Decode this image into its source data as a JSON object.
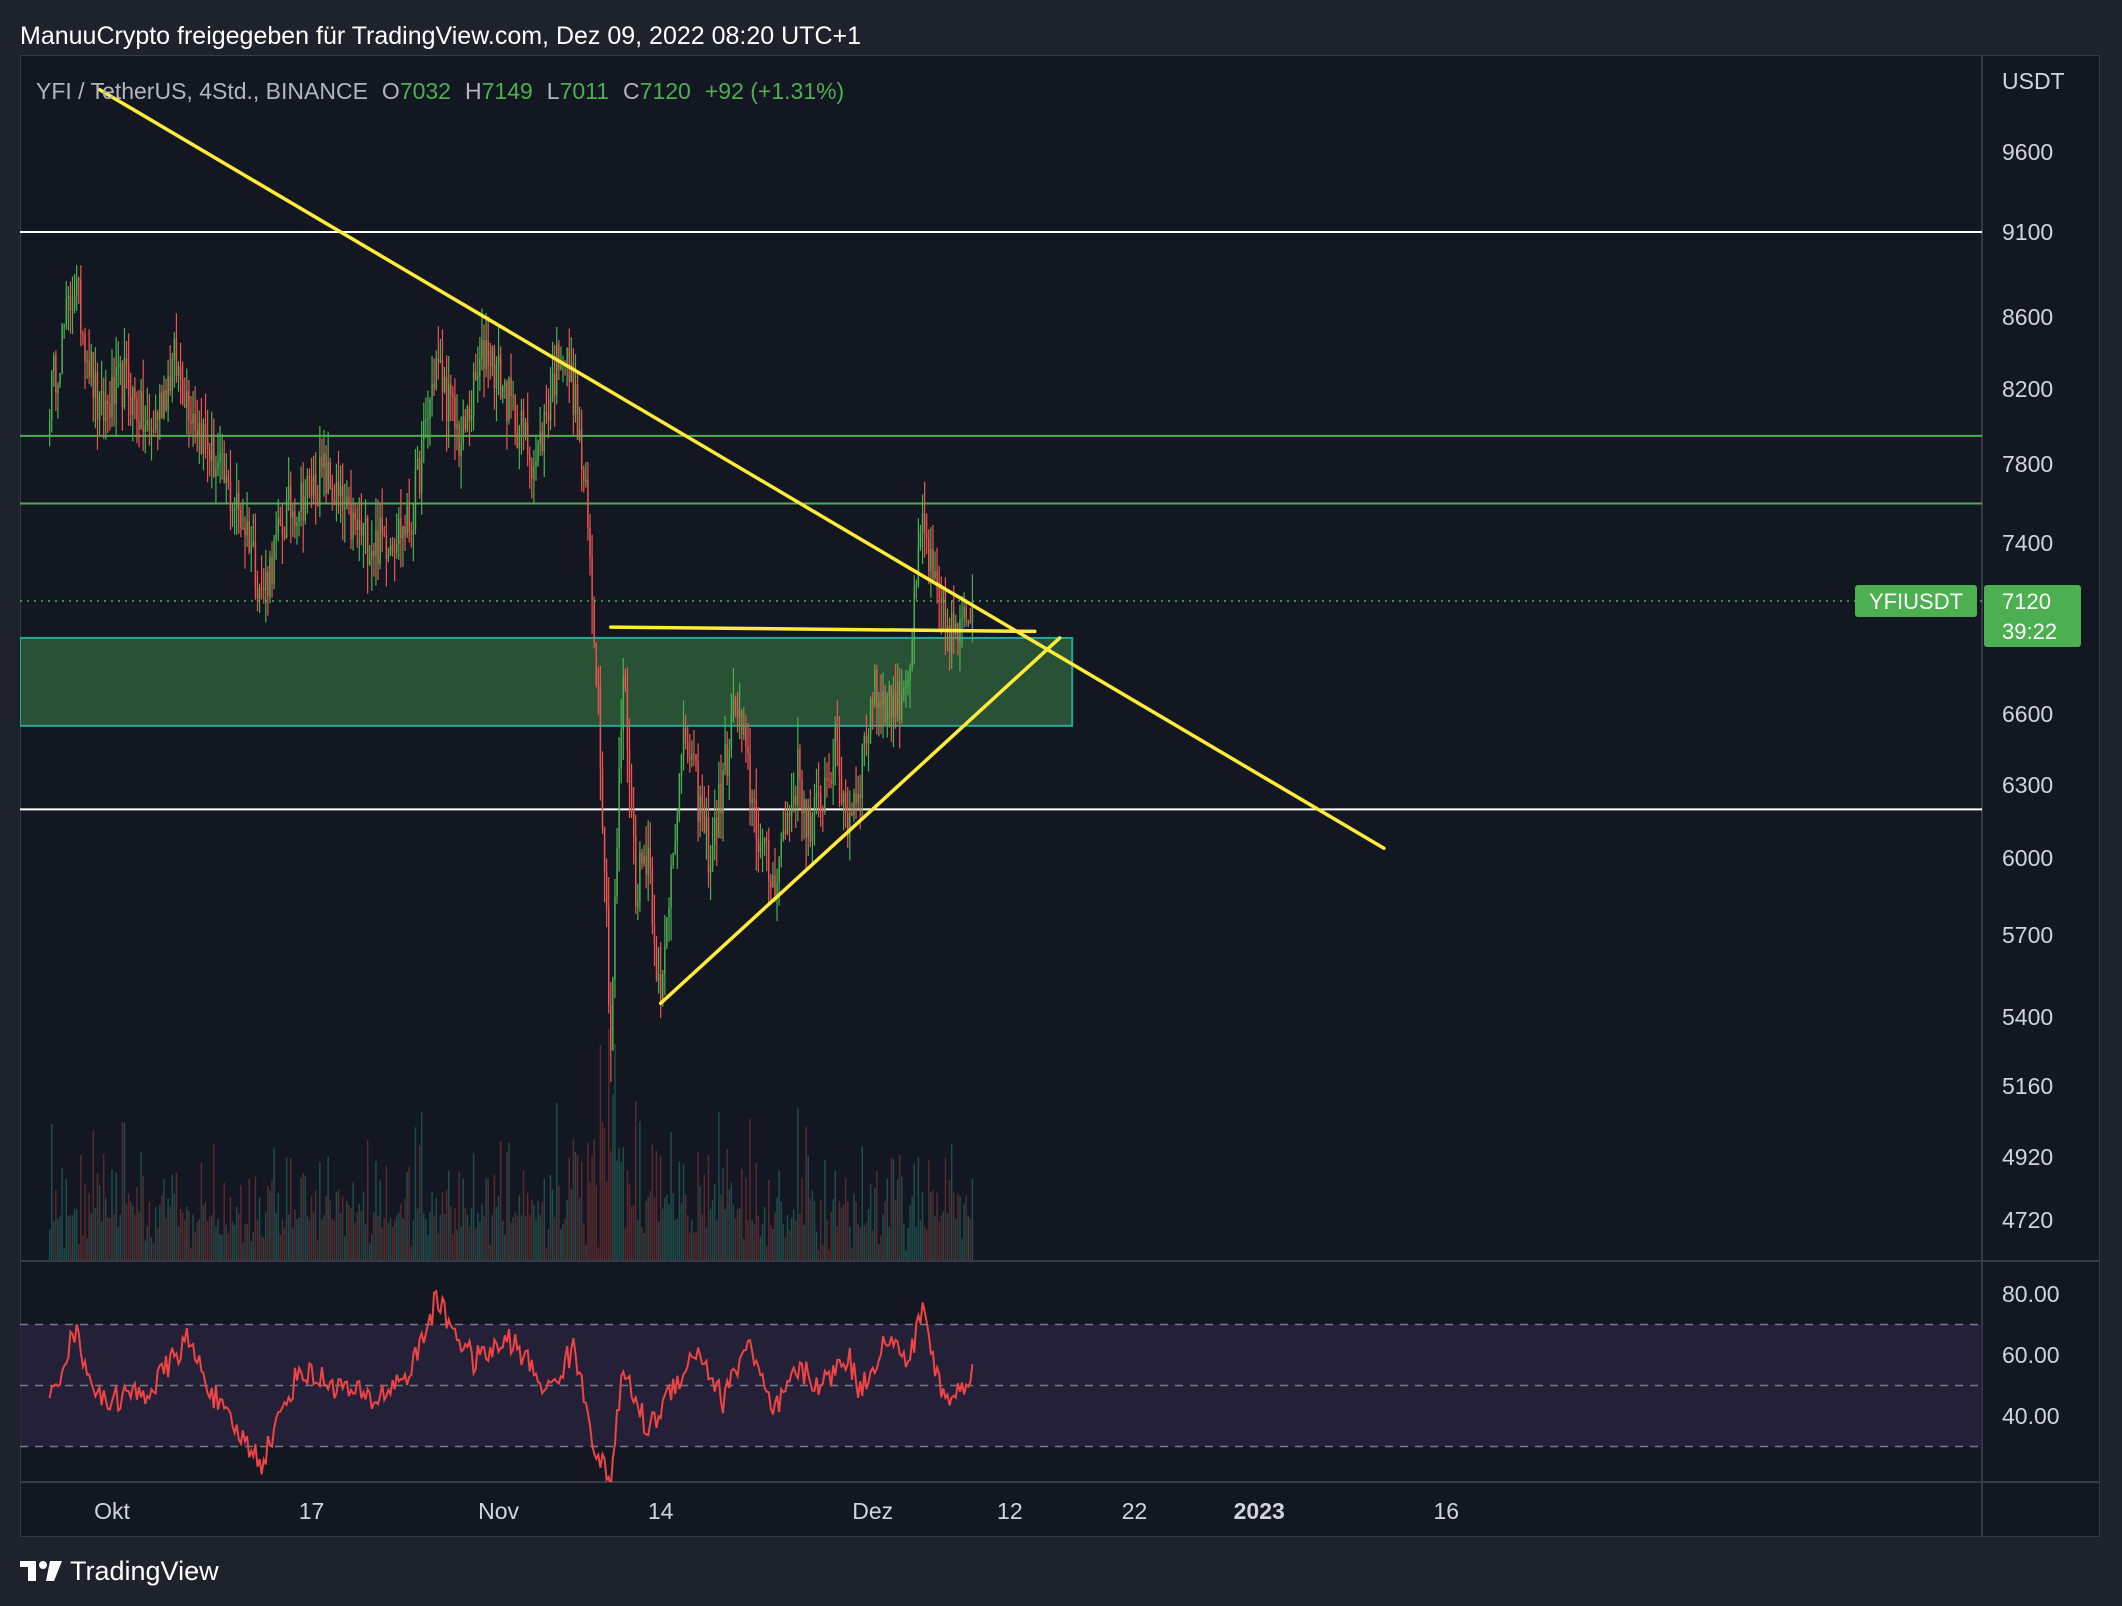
{
  "header_text": "ManuuCrypto freigegeben für TradingView.com, Dez 09, 2022 08:20 UTC+1",
  "footer_brand": "TradingView",
  "legend": {
    "symbol": "YFI / TetherUS, 4Std., BINANCE",
    "o_label": "O",
    "o_value": "7032",
    "h_label": "H",
    "h_value": "7149",
    "l_label": "L",
    "l_value": "7011",
    "c_label": "C",
    "c_value": "7120",
    "change": "+92 (+1.31%)"
  },
  "colors": {
    "up": "#26a69a",
    "up_body": "#4caf50",
    "down": "#ef5350",
    "trendline": "#ffeb3b",
    "zone": "#2e5c38",
    "badge": "#4caf50",
    "rsi_line": "#ef4444"
  },
  "chart_data": {
    "type": "candlestick",
    "symbol": "YFIUSDT",
    "timeframe": "4Std.",
    "price_axis_unit": "USDT",
    "price_ticks": [
      9600,
      9100,
      8600,
      8200,
      7800,
      7400,
      6600,
      6300,
      6000,
      5700,
      5400,
      5160,
      4920,
      4720
    ],
    "time_ticks": [
      {
        "label": "Okt",
        "date": "2022-10-01",
        "bold": false
      },
      {
        "label": "17",
        "date": "2022-10-17",
        "bold": false
      },
      {
        "label": "Nov",
        "date": "2022-11-01",
        "bold": false
      },
      {
        "label": "14",
        "date": "2022-11-14",
        "bold": false
      },
      {
        "label": "Dez",
        "date": "2022-12-01",
        "bold": false
      },
      {
        "label": "12",
        "date": "2022-12-12",
        "bold": false
      },
      {
        "label": "22",
        "date": "2022-12-22",
        "bold": false
      },
      {
        "label": "2023",
        "date": "2023-01-01",
        "bold": true
      },
      {
        "label": "16",
        "date": "2023-01-16",
        "bold": false
      }
    ],
    "series_anchors": [
      [
        "2022-09-26",
        8150
      ],
      [
        "2022-09-28",
        8800
      ],
      [
        "2022-09-30",
        8050
      ],
      [
        "2022-10-02",
        8250
      ],
      [
        "2022-10-04",
        7950
      ],
      [
        "2022-10-06",
        8350
      ],
      [
        "2022-10-08",
        8000
      ],
      [
        "2022-10-10",
        7700
      ],
      [
        "2022-10-12",
        7450
      ],
      [
        "2022-10-13",
        7150
      ],
      [
        "2022-10-15",
        7550
      ],
      [
        "2022-10-18",
        7750
      ],
      [
        "2022-10-20",
        7500
      ],
      [
        "2022-10-22",
        7400
      ],
      [
        "2022-10-25",
        7500
      ],
      [
        "2022-10-27",
        8350
      ],
      [
        "2022-10-29",
        7900
      ],
      [
        "2022-10-31",
        8450
      ],
      [
        "2022-11-02",
        8100
      ],
      [
        "2022-11-04",
        7800
      ],
      [
        "2022-11-06",
        8450
      ],
      [
        "2022-11-07",
        8200
      ],
      [
        "2022-11-08",
        7600
      ],
      [
        "2022-11-09",
        6700
      ],
      [
        "2022-11-10",
        5300
      ],
      [
        "2022-11-11",
        6800
      ],
      [
        "2022-11-12",
        5900
      ],
      [
        "2022-11-13",
        6050
      ],
      [
        "2022-11-14",
        5400
      ],
      [
        "2022-11-15",
        6100
      ],
      [
        "2022-11-16",
        6500
      ],
      [
        "2022-11-18",
        6000
      ],
      [
        "2022-11-20",
        6650
      ],
      [
        "2022-11-22",
        6050
      ],
      [
        "2022-11-23",
        5900
      ],
      [
        "2022-11-25",
        6350
      ],
      [
        "2022-11-26",
        6100
      ],
      [
        "2022-11-28",
        6450
      ],
      [
        "2022-11-29",
        6150
      ],
      [
        "2022-11-30",
        6350
      ],
      [
        "2022-12-01",
        6700
      ],
      [
        "2022-12-03",
        6650
      ],
      [
        "2022-12-04",
        6850
      ],
      [
        "2022-12-05",
        7500
      ],
      [
        "2022-12-06",
        7150
      ],
      [
        "2022-12-07",
        7000
      ],
      [
        "2022-12-08",
        6950
      ],
      [
        "2022-12-09",
        7120
      ]
    ],
    "candles_per_day": 6,
    "last_price": 7120,
    "horizontal_levels": [
      {
        "price": 9100,
        "color": "#ffffff"
      },
      {
        "price": 7950,
        "color": "#4caf50"
      },
      {
        "price": 7600,
        "color": "#4caf50"
      },
      {
        "price": 6200,
        "color": "#ffffff"
      }
    ],
    "zone": {
      "from_date": "2022-09-26",
      "to_date": "2022-12-17",
      "low": 6550,
      "high": 6950
    },
    "trendlines": [
      {
        "name": "descending-resistance",
        "from": [
          "2022-09-30",
          9990
        ],
        "to": [
          "2023-01-11",
          6040
        ]
      },
      {
        "name": "ascending-support",
        "from": [
          "2022-11-14",
          5450
        ],
        "to": [
          "2022-12-16",
          6950
        ]
      },
      {
        "name": "flat-top",
        "from": [
          "2022-11-10",
          7000
        ],
        "to": [
          "2022-12-14",
          6980
        ]
      }
    ],
    "price_badge": {
      "label": "YFIUSDT",
      "value": "7120",
      "countdown": "39:22"
    },
    "rsi": {
      "ticks": [
        80,
        60,
        40
      ],
      "upper_band": 70,
      "lower_band": 30,
      "mid_line": 50,
      "anchors": [
        [
          "2022-09-26",
          45
        ],
        [
          "2022-09-28",
          68
        ],
        [
          "2022-09-30",
          45
        ],
        [
          "2022-10-04",
          48
        ],
        [
          "2022-10-07",
          65
        ],
        [
          "2022-10-10",
          40
        ],
        [
          "2022-10-13",
          25
        ],
        [
          "2022-10-16",
          55
        ],
        [
          "2022-10-19",
          50
        ],
        [
          "2022-10-22",
          45
        ],
        [
          "2022-10-25",
          55
        ],
        [
          "2022-10-27",
          78
        ],
        [
          "2022-10-30",
          58
        ],
        [
          "2022-11-02",
          65
        ],
        [
          "2022-11-05",
          48
        ],
        [
          "2022-11-07",
          62
        ],
        [
          "2022-11-08",
          45
        ],
        [
          "2022-11-09",
          25
        ],
        [
          "2022-11-10",
          20
        ],
        [
          "2022-11-11",
          55
        ],
        [
          "2022-11-13",
          35
        ],
        [
          "2022-11-15",
          50
        ],
        [
          "2022-11-17",
          62
        ],
        [
          "2022-11-19",
          45
        ],
        [
          "2022-11-21",
          65
        ],
        [
          "2022-11-23",
          40
        ],
        [
          "2022-11-25",
          55
        ],
        [
          "2022-11-27",
          50
        ],
        [
          "2022-11-29",
          60
        ],
        [
          "2022-11-30",
          48
        ],
        [
          "2022-12-02",
          65
        ],
        [
          "2022-12-04",
          58
        ],
        [
          "2022-12-05",
          77
        ],
        [
          "2022-12-06",
          55
        ],
        [
          "2022-12-07",
          45
        ],
        [
          "2022-12-08",
          48
        ],
        [
          "2022-12-09",
          57
        ]
      ]
    }
  }
}
